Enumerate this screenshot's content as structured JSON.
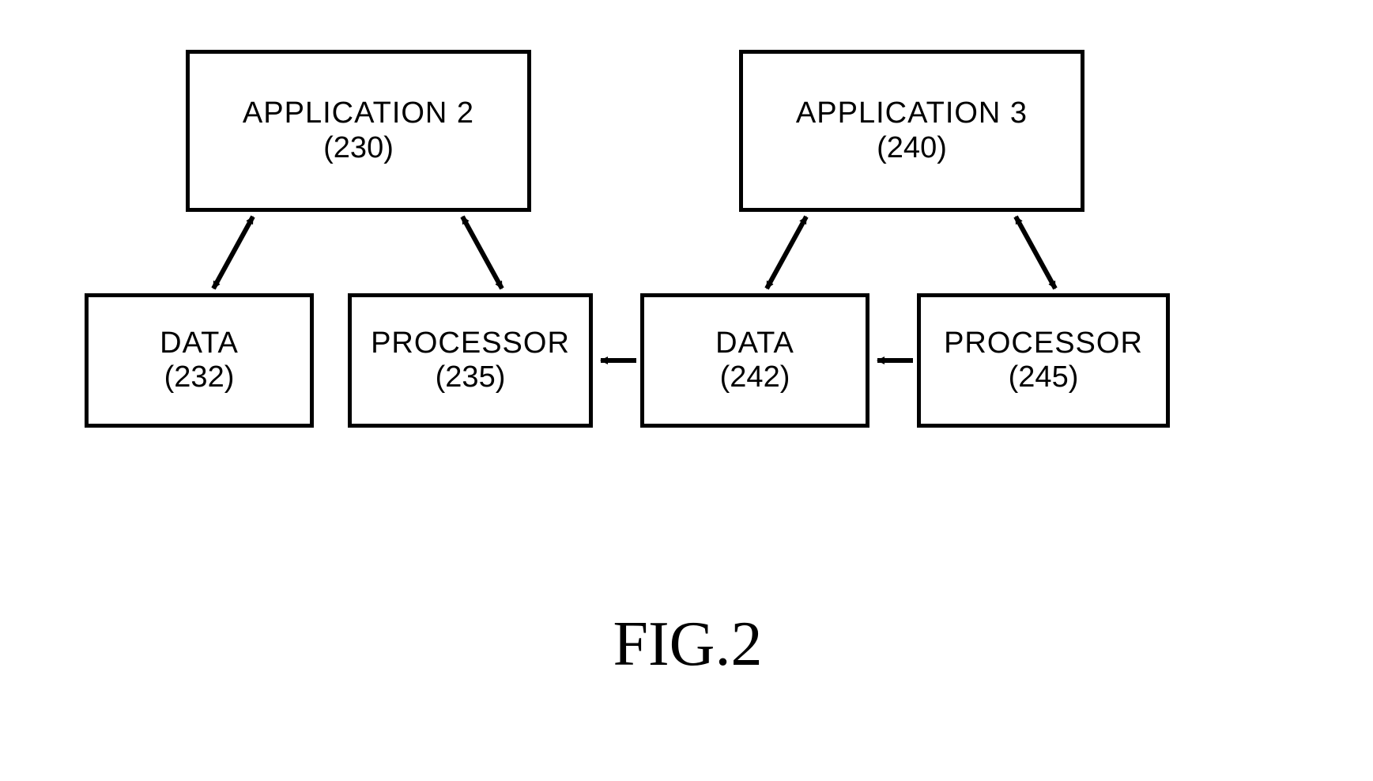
{
  "boxes": {
    "app2": {
      "title": "APPLICATION 2",
      "num": "(230)"
    },
    "app3": {
      "title": "APPLICATION 3",
      "num": "(240)"
    },
    "data232": {
      "title": "DATA",
      "num": "(232)"
    },
    "proc235": {
      "title": "PROCESSOR",
      "num": "(235)"
    },
    "data242": {
      "title": "DATA",
      "num": "(242)"
    },
    "proc245": {
      "title": "PROCESSOR",
      "num": "(245)"
    }
  },
  "caption": "FIG.2"
}
